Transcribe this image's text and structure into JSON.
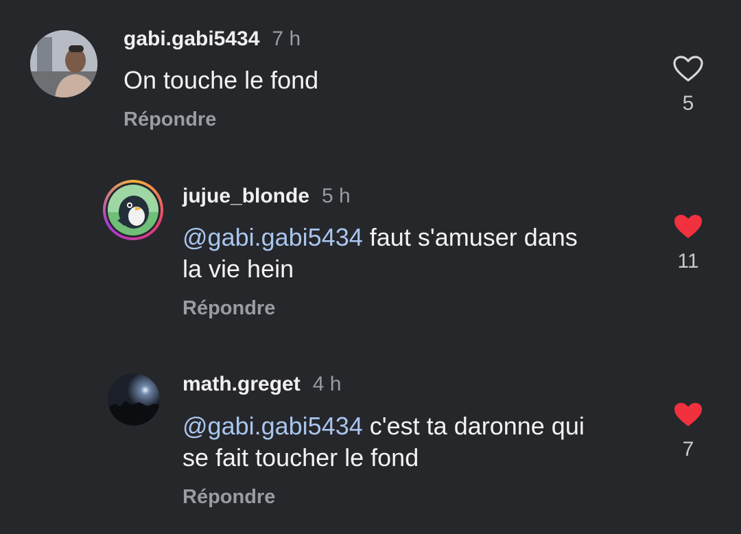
{
  "comments": [
    {
      "username": "gabi.gabi5434",
      "time": "7 h",
      "mention": "",
      "text_line1": "On touche le fond",
      "text_line2": "",
      "reply_label": "Répondre",
      "likes": "5",
      "liked": false,
      "avatar": "avatar-man-photo"
    },
    {
      "username": "jujue_blonde",
      "time": "5 h",
      "mention": "@gabi.gabi5434",
      "text_line1": " faut s'amuser dans",
      "text_line2": "la vie hein",
      "reply_label": "Répondre",
      "likes": "11",
      "liked": true,
      "avatar": "avatar-penguin-cartoon"
    },
    {
      "username": "math.greget",
      "time": "4 h",
      "mention": "@gabi.gabi5434",
      "text_line1": " c'est ta daronne qui",
      "text_line2": "se fait toucher le fond",
      "reply_label": "Répondre",
      "likes": "7",
      "liked": true,
      "avatar": "avatar-night-sky"
    }
  ],
  "colors": {
    "background": "#26272b",
    "mention": "#a9c6ee",
    "liked_heart": "#f2313f",
    "muted_text": "#9a9ca1"
  }
}
